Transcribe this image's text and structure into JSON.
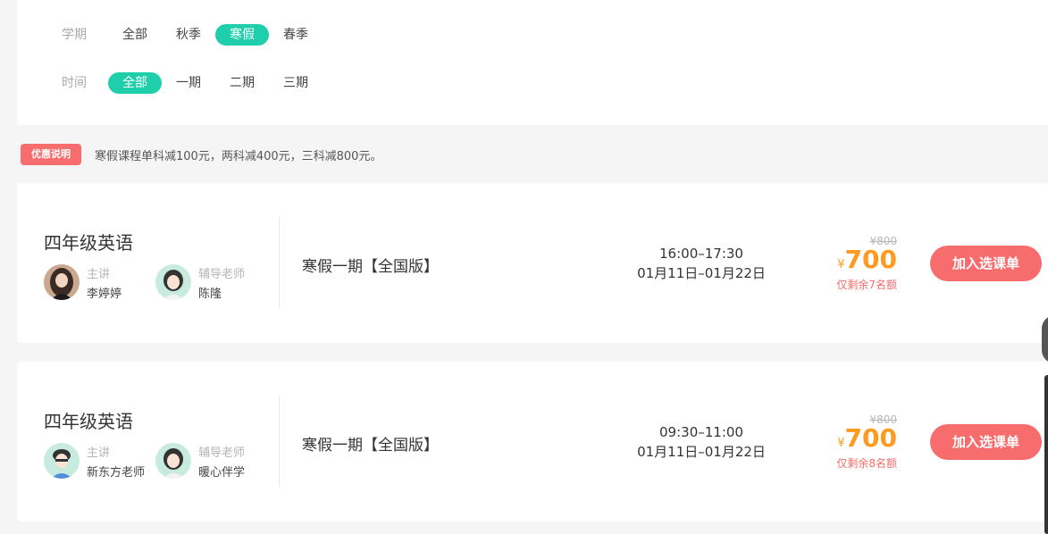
{
  "filters": {
    "term": {
      "label": "学期",
      "options": [
        "全部",
        "秋季",
        "寒假",
        "春季"
      ],
      "selected": "寒假"
    },
    "time": {
      "label": "时间",
      "options": [
        "全部",
        "一期",
        "二期",
        "三期"
      ],
      "selected": "全部"
    }
  },
  "promo": {
    "tag": "优惠说明",
    "text": "寒假课程单科减100元，两科减400元，三科减800元。"
  },
  "courses": [
    {
      "title": "四年级英语",
      "lead_role": "主讲",
      "lead_name": "李婷婷",
      "tutor_role": "辅导老师",
      "tutor_name": "陈隆",
      "term": "寒假一期【全国版】",
      "time": "16:00–17:30",
      "dates": "01月11日–01月22日",
      "original_price": "¥800",
      "currency": "¥",
      "price": "700",
      "remaining": "仅剩余7名额",
      "button": "加入选课单"
    },
    {
      "title": "四年级英语",
      "lead_role": "主讲",
      "lead_name": "新东方老师",
      "tutor_role": "辅导老师",
      "tutor_name": "暖心伴学",
      "term": "寒假一期【全国版】",
      "time": "09:30–11:00",
      "dates": "01月11日–01月22日",
      "original_price": "¥800",
      "currency": "¥",
      "price": "700",
      "remaining": "仅剩余8名额",
      "button": "加入选课单"
    }
  ],
  "colors": {
    "accent_teal": "#1fcfab",
    "accent_red": "#f76c6c",
    "price_orange": "#ff9a1f"
  }
}
